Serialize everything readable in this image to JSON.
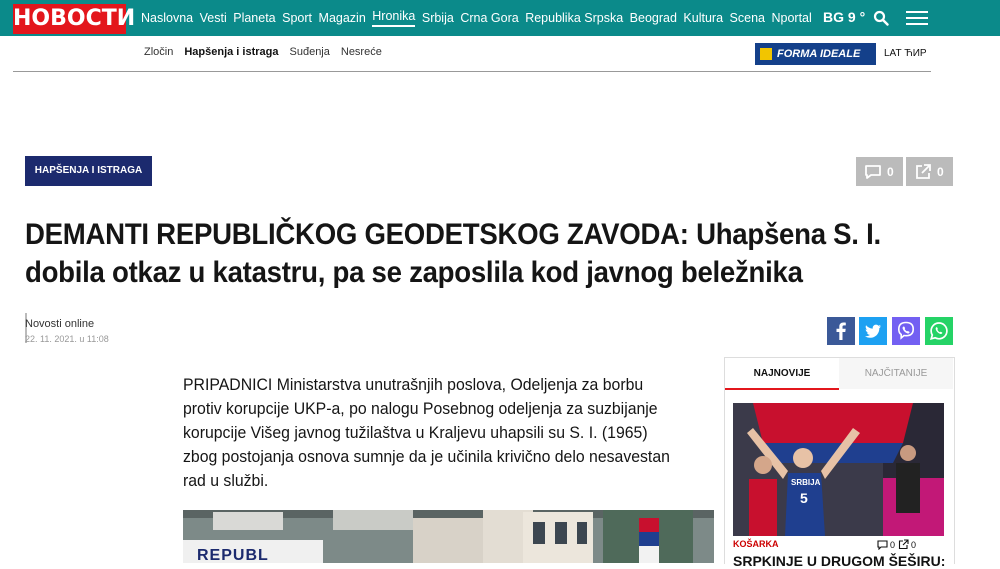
{
  "header": {
    "logo": "НОВОСТИ",
    "nav": [
      {
        "label": "Naslovna"
      },
      {
        "label": "Vesti"
      },
      {
        "label": "Planeta"
      },
      {
        "label": "Sport"
      },
      {
        "label": "Magazin"
      },
      {
        "label": "Hronika",
        "active": true
      },
      {
        "label": "Srbija"
      },
      {
        "label": "Crna Gora"
      },
      {
        "label": "Republika Srpska"
      },
      {
        "label": "Beograd"
      },
      {
        "label": "Kultura"
      },
      {
        "label": "Scena"
      },
      {
        "label": "Nportal"
      }
    ],
    "weather": "BG 9 °",
    "search_icon": "search-icon",
    "menu_icon": "hamburger-menu-icon"
  },
  "subnav": {
    "items": [
      {
        "label": "Zločin"
      },
      {
        "label": "Hapšenja i istraga",
        "active": true
      },
      {
        "label": "Suđenja"
      },
      {
        "label": "Nesreće"
      }
    ],
    "sponsor": "FORMA IDEALE",
    "lang": "LAT ЋИР"
  },
  "article": {
    "category": "HAPŠENJA I ISTRAGA",
    "comments_count": "0",
    "shares_count": "0",
    "title": "DEMANTI REPUBLIČKOG GEODETSKOG ZAVODA: Uhapšena S. I. dobila otkaz u katastru, pa se zaposlila kod javnog beležnika",
    "author": "Novosti online",
    "date": "22. 11. 2021. u 11:08",
    "lead": "PRIPADNICI Ministarstva unutrašnjih poslova, Odeljenja za borbu protiv korupcije UKP-a, po nalogu Posebnog odeljenja za suzbijanje korupcije Višeg javnog tužilaštva u Kraljevu uhapsili su S. I. (1965) zbog postojanja osnova sumnje da je učinila krivično delo nesavestan rad u službi.",
    "photo_sign": "REPUBL",
    "share": {
      "facebook_color": "#3b5998",
      "twitter_color": "#1da1f2",
      "viber_color": "#7360f2",
      "whatsapp_color": "#25d366"
    }
  },
  "sidebar": {
    "tabs": [
      {
        "label": "NAJNOVIJE"
      },
      {
        "label": "NAJČITANIJE"
      }
    ],
    "item": {
      "jersey_text": "SRBIJA",
      "jersey_number": "5",
      "category": "KOŠARKA",
      "comments": "0",
      "shares": "0",
      "title": "SRPKINJE U DRUGOM ŠEŠIRU:"
    }
  },
  "colors": {
    "topbar": "#0b8a8a",
    "logo": "#e3161c",
    "badge": "#1c2a6e"
  }
}
